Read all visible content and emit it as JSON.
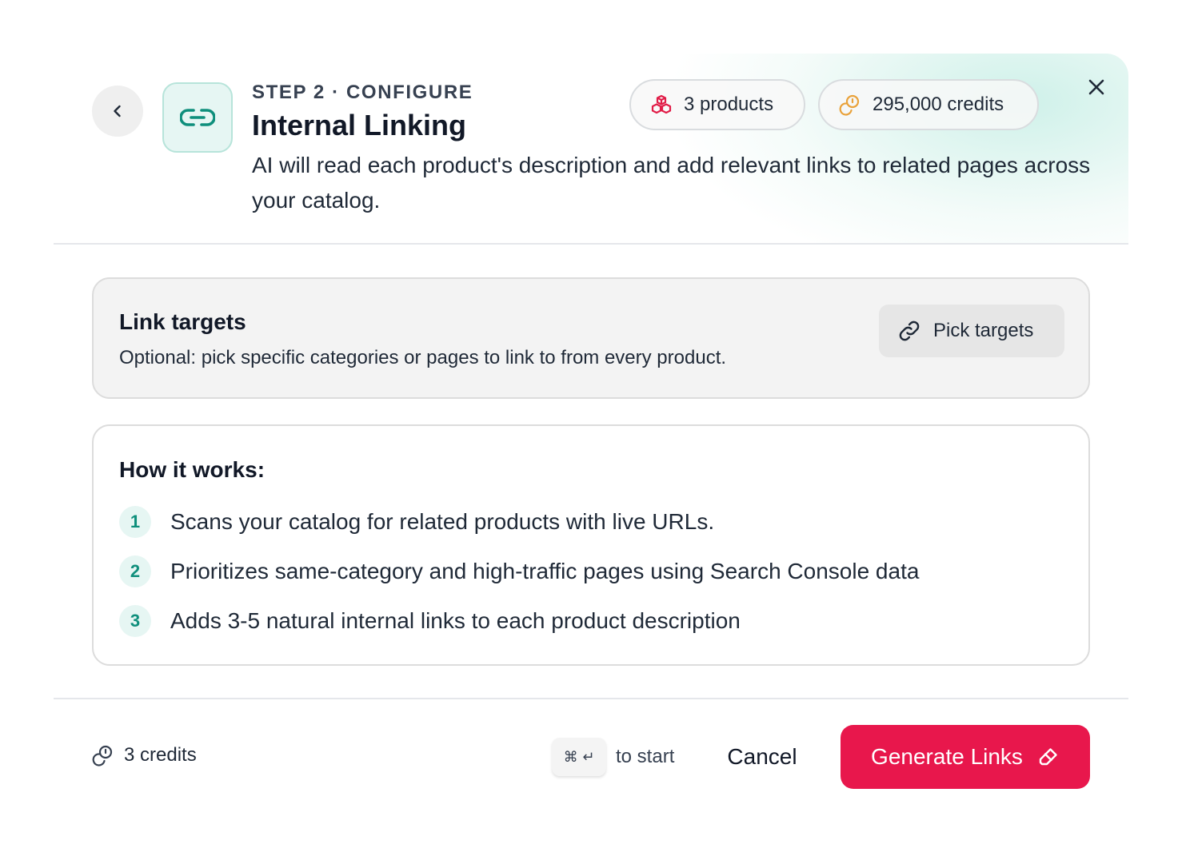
{
  "header": {
    "step_label": "STEP 2 · CONFIGURE",
    "title": "Internal Linking",
    "description": "AI will read each product's description and add relevant links to related pages across your catalog.",
    "back_icon": "chevron-left-icon",
    "feature_icon": "link-icon",
    "close_icon": "close-icon"
  },
  "stats": {
    "products": {
      "label": "3 products",
      "icon": "boxes-icon",
      "color": "#e11d48"
    },
    "credits": {
      "label": "295,000 credits",
      "icon": "coins-icon",
      "color": "#e9a23b"
    }
  },
  "link_targets": {
    "title": "Link targets",
    "subtitle": "Optional: pick specific categories or pages to link to from every product.",
    "button_label": "Pick targets",
    "button_icon": "link-icon"
  },
  "how_it_works": {
    "title": "How it works:",
    "steps": [
      {
        "number": "1",
        "text": "Scans your catalog for related products with live URLs."
      },
      {
        "number": "2",
        "text": "Prioritizes same-category and high-traffic pages using Search Console data"
      },
      {
        "number": "3",
        "text": "Adds 3-5 natural internal links to each product description"
      }
    ]
  },
  "footer": {
    "credits_label": "3 credits",
    "credits_icon": "coins-icon",
    "shortcut_keys": "⌘ ↵",
    "shortcut_hint": "to start",
    "cancel_label": "Cancel",
    "generate_label": "Generate Links",
    "generate_icon": "eraser-icon"
  },
  "colors": {
    "accent_teal": "#0f8f7c",
    "primary_red": "#e8174c",
    "header_tint": "#ccf0e8"
  }
}
